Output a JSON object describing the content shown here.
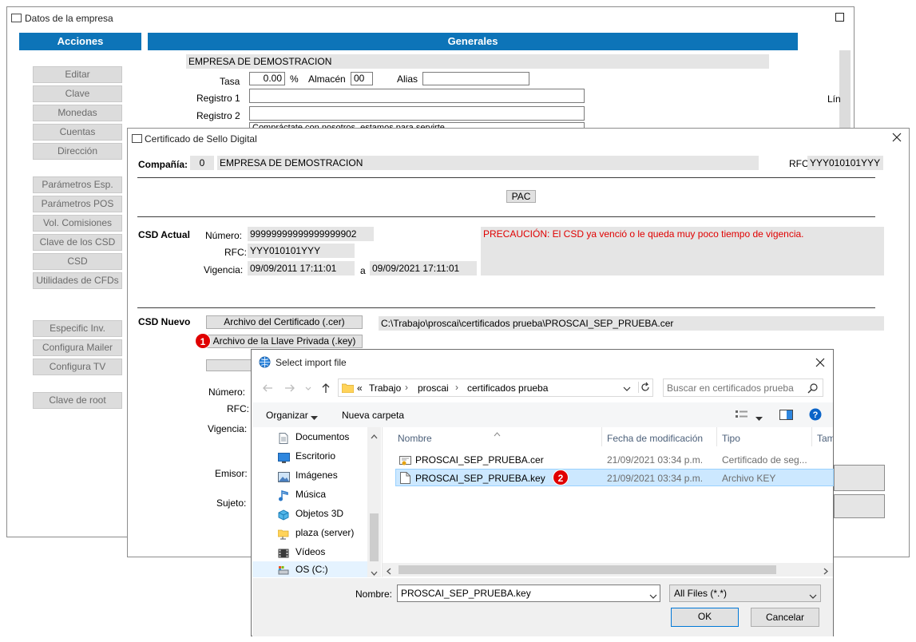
{
  "empresa_window": {
    "title": "Datos de la empresa",
    "acciones_header": "Acciones",
    "generales_header": "Generales",
    "acciones": [
      "Editar",
      "Clave",
      "Monedas",
      "Cuentas",
      "Dirección",
      "Parámetros Esp.",
      "Parámetros POS",
      "Vol. Comisiones",
      "Clave de los CSD",
      "CSD",
      "Utilidades de CFDs",
      "Especific Inv.",
      "Configura Mailer",
      "Configura TV",
      "Clave de root"
    ],
    "company_name": "EMPRESA DE DEMOSTRACION",
    "tasa_label": "Tasa",
    "tasa_value": "0.00",
    "percent": "%",
    "almacen_label": "Almacén",
    "almacen_value": "00",
    "alias_label": "Alias",
    "registro1_label": "Registro 1",
    "registro2_label": "Registro 2",
    "registro3_value": "Compráctate con nosotros, estamos para servirte",
    "lin_label": "Lín"
  },
  "csd_window": {
    "title": "Certificado de Sello Digital",
    "compania_label": "Compañía:",
    "compania_num": "0",
    "compania_name": "EMPRESA DE DEMOSTRACION",
    "rfc_label": "RFC",
    "rfc_value": "YYY010101YYY",
    "pac_button": "PAC",
    "csd_actual_label": "CSD Actual",
    "numero_label": "Número:",
    "numero_value": "99999999999999999902",
    "rfc2_label": "RFC:",
    "rfc2_value": "YYY010101YYY",
    "vigencia_label": "Vigencia:",
    "vigencia_from": "09/09/2011 17:11:01",
    "a_label": "a",
    "vigencia_to": "09/09/2021 17:11:01",
    "warning": "PRECAUCIÓN: El CSD ya venció o le queda muy poco tiempo de vigencia.",
    "csd_nuevo_label": "CSD Nuevo",
    "cert_button": "Archivo del Certificado (.cer)",
    "cert_path": "C:\\Trabajo\\proscai\\certificados prueba\\PROSCAI_SEP_PRUEBA.cer",
    "key_button": "Archivo de la Llave Privada (.key)",
    "numero2_label": "Número:",
    "rfc3_label": "RFC:",
    "vigencia2_label": "Vigencia:",
    "emisor_label": "Emisor:",
    "sujeto_label": "Sujeto:",
    "badge1": "1",
    "badge2": "2"
  },
  "file_dialog": {
    "title": "Select import file",
    "breadcrumb": [
      "«",
      "Trabajo",
      "proscai",
      "certificados prueba"
    ],
    "search_placeholder": "Buscar en certificados prueba",
    "organizar": "Organizar",
    "nueva_carpeta": "Nueva carpeta",
    "nav_items": [
      "Documentos",
      "Escritorio",
      "Imágenes",
      "Música",
      "Objetos 3D",
      "plaza (server)",
      "Vídeos",
      "OS (C:)"
    ],
    "columns": {
      "nombre": "Nombre",
      "fecha": "Fecha de modificación",
      "tipo": "Tipo",
      "tam": "Tam"
    },
    "files": [
      {
        "name": "PROSCAI_SEP_PRUEBA.cer",
        "date": "21/09/2021 03:34 p.m.",
        "type": "Certificado de seg..."
      },
      {
        "name": "PROSCAI_SEP_PRUEBA.key",
        "date": "21/09/2021 03:34 p.m.",
        "type": "Archivo KEY"
      }
    ],
    "nombre_label": "Nombre:",
    "nombre_value": "PROSCAI_SEP_PRUEBA.key",
    "filter_value": "All Files (*.*)",
    "ok": "OK",
    "cancel": "Cancelar"
  },
  "colors": {
    "header_blue": "#0d74b8",
    "warning_red": "#e00000",
    "selection": "#cce8ff"
  }
}
